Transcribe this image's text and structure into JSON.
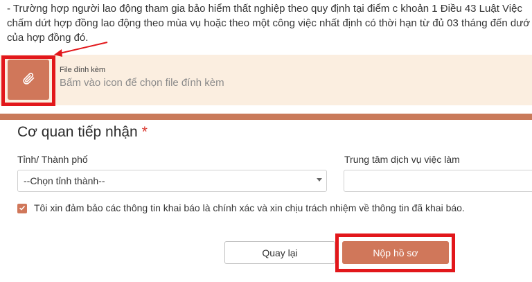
{
  "notice": {
    "line1": "- Trường hợp người lao động tham gia bảo hiểm thất nghiệp theo quy định tại điểm c khoản 1 Điều 43 Luật Việc",
    "line2": "chấm dứt hợp đồng lao động theo mùa vụ hoặc theo một công việc nhất định có thời hạn từ đủ 03 tháng đến dướ",
    "line3": "của hợp đồng đó."
  },
  "attachment": {
    "label": "File đính kèm",
    "hint": "Bấm vào icon để chọn file đính kèm",
    "icon": "paperclip-icon"
  },
  "receiving_agency": {
    "title": "Cơ quan tiếp nhận",
    "required_mark": "*",
    "province": {
      "label": "Tỉnh/ Thành phố",
      "selected": "--Chọn tỉnh thành--"
    },
    "center": {
      "label": "Trung tâm dịch vụ việc làm",
      "selected": ""
    }
  },
  "consent": {
    "checked": true,
    "text": "Tôi xin đảm bảo các thông tin khai báo là chính xác và xin chịu trách nhiệm về thông tin đã khai báo."
  },
  "actions": {
    "back_label": "Quay lại",
    "submit_label": "Nộp hồ sơ"
  },
  "colors": {
    "accent": "#d0775a",
    "highlight": "#e2171b",
    "band": "#fbeee0"
  }
}
